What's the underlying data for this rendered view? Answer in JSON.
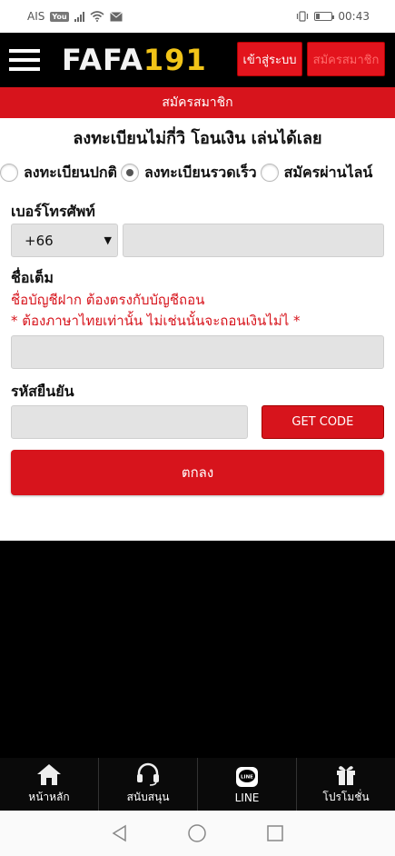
{
  "status_bar": {
    "carrier_badge": "AIS",
    "yt_badge": "YouTube",
    "time": "00:43"
  },
  "header": {
    "logo_part1": "FAFA",
    "logo_part2": "191",
    "login_label": "เข้าสู่ระบบ",
    "register_label": "สมัครสมาชิก"
  },
  "banner": {
    "title": "สมัครสมาชิก"
  },
  "subtitle": "ลงทะเบียนไม่กี่วิ โอนเงิน เล่นได้เลย",
  "register_options": [
    {
      "label": "ลงทะเบียนปกติ",
      "checked": false
    },
    {
      "label": "ลงทะเบียนรวดเร็ว",
      "checked": true
    },
    {
      "label": "สมัครผ่านไลน์",
      "checked": false
    }
  ],
  "form": {
    "phone_label": "เบอร์โทรศัพท์",
    "country_code": "+66",
    "phone_value": "",
    "name_label": "ชื่อเต็ม",
    "name_hint1": "ชื่อบัญชีฝาก ต้องตรงกับบัญชีถอน",
    "name_hint2": "* ต้องภาษาไทยเท่านั้น ไม่เช่นนั้นจะถอนเงินไม่ไ *",
    "name_value": "",
    "code_label": "รหัสยืนยัน",
    "code_value": "",
    "get_code_label": "GET CODE",
    "submit_label": "ตกลง"
  },
  "bottom_nav": [
    {
      "label": "หน้าหลัก",
      "icon": "home-icon"
    },
    {
      "label": "สนับสนุน",
      "icon": "headset-icon"
    },
    {
      "label": "LINE",
      "icon": "line-icon"
    },
    {
      "label": "โปรโมชั่น",
      "icon": "gift-icon"
    }
  ],
  "colors": {
    "brand_red": "#d7141c",
    "logo_gold": "#f2c418"
  }
}
